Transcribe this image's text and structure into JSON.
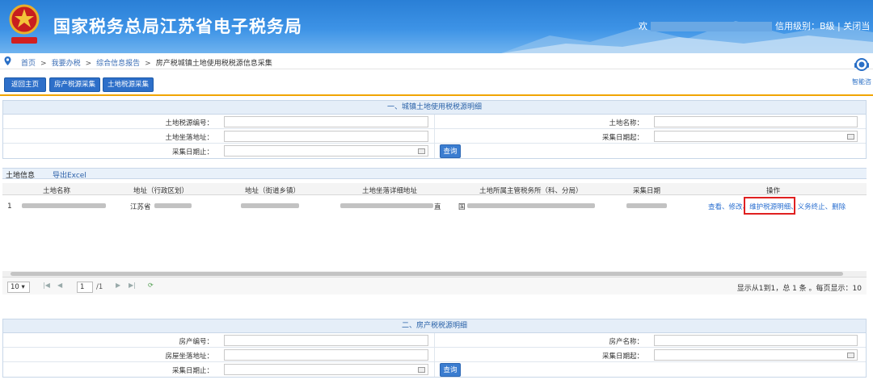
{
  "header": {
    "title": "国家税务总局江苏省电子税务局",
    "welcome_prefix": "欢",
    "credit_level": "信用级别：B级",
    "separator": "|",
    "close_label": "关闭当"
  },
  "breadcrumb": {
    "items": [
      "首页",
      "我要办税",
      "综合信息报告",
      "房产税城镇土地使用税税源信息采集"
    ],
    "sep": ">"
  },
  "assistant": {
    "label": "智能咨"
  },
  "toolbar": {
    "home_label": "返回主页",
    "house_label": "房产税源采集",
    "land_label": "土地税源采集"
  },
  "land_query": {
    "title": "一、城镇土地使用税税源明细",
    "source_no_label": "土地税源编号：",
    "name_label": "土地名称：",
    "address_label": "土地坐落地址：",
    "date_from_label": "采集日期起：",
    "date_to_label": "采集日期止：",
    "query_label": "查询"
  },
  "grid": {
    "tab_active": "土地信息",
    "tab_export": "导出Excel",
    "columns": [
      "土地名称",
      "地址（行政区划）",
      "地址（街道乡镇）",
      "土地坐落详细地址",
      "土地所属主管税务所（科、分局）",
      "采集日期",
      "操作"
    ],
    "rows": [
      {
        "index": "1",
        "province": "江苏省",
        "address_tail": "直",
        "office_prefix": "国"
      }
    ],
    "operations": [
      "查看",
      "修改",
      "维护税源明细",
      "义务终止",
      "删除"
    ],
    "operations_text": "查看、修改、维护税源明细、义务终止、删除"
  },
  "pager": {
    "page_size": "10",
    "current_page": "1",
    "total_pages": "/1",
    "info": "显示从1到1，总 1 条 。每页显示：10"
  },
  "house_query": {
    "title": "二、房产税税源明细",
    "house_no_label": "房产编号：",
    "name_label": "房产名称：",
    "address_label": "房屋坐落地址：",
    "date_from_label": "采集日期起：",
    "date_to_label": "采集日期止：",
    "query_label": "查询"
  },
  "colors": {
    "banner": "#2a7fd6",
    "accent": "#2d6fc9",
    "highlight": "#e02020",
    "divider": "#f0a500"
  }
}
